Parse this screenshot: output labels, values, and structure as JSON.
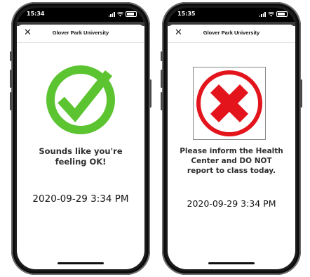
{
  "screens": [
    {
      "status_time": "15:34",
      "header_title": "Glover Park University",
      "result": "ok",
      "message": "Sounds like you're feeling OK!",
      "timestamp": "2020-09-29 3:34 PM",
      "icon": "green-check-icon",
      "accent": "#5cc430"
    },
    {
      "status_time": "15:35",
      "header_title": "Glover Park University",
      "result": "not-ok",
      "message": "Please inform the Health Center and DO NOT report to class today.",
      "timestamp": "2020-09-29 3:34 PM",
      "icon": "red-x-icon",
      "accent": "#e3141b"
    }
  ]
}
